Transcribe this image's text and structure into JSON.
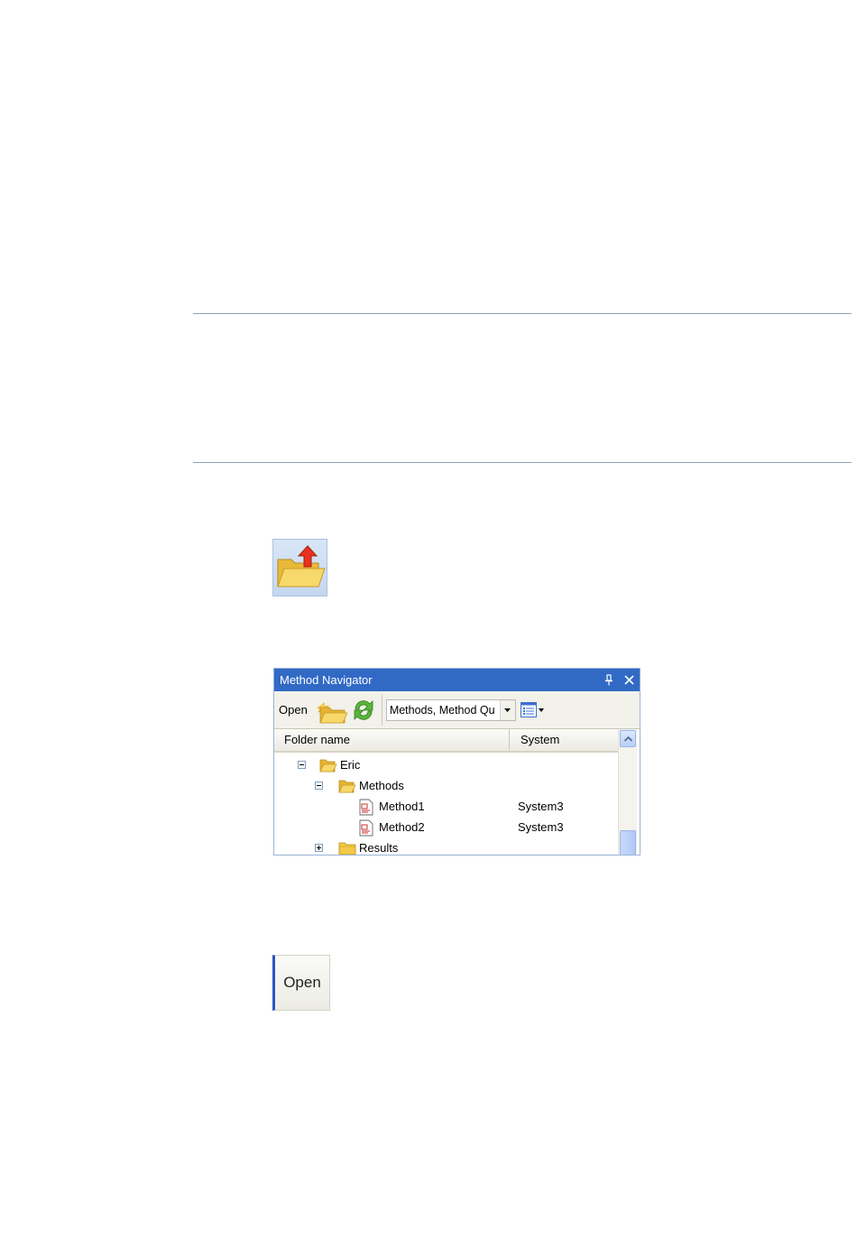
{
  "navigator": {
    "title": "Method Navigator",
    "toolbar": {
      "open_label": "Open",
      "filter_value": "Methods, Method Qu"
    },
    "columns": {
      "folder": "Folder name",
      "system": "System"
    },
    "tree": [
      {
        "label": "Eric",
        "system": "",
        "kind": "folder-open",
        "expander": "minus"
      },
      {
        "label": "Methods",
        "system": "",
        "kind": "folder-open",
        "expander": "minus"
      },
      {
        "label": "Method1",
        "system": "System3",
        "kind": "method-file",
        "expander": ""
      },
      {
        "label": "Method2",
        "system": "System3",
        "kind": "method-file",
        "expander": ""
      },
      {
        "label": "Results",
        "system": "",
        "kind": "folder",
        "expander": "plus"
      }
    ]
  },
  "open_button": {
    "label": "Open"
  },
  "icons": {
    "big_icon": "open-folder-icon",
    "new_folder": "new-folder-icon",
    "refresh": "refresh-icon",
    "view_list": "view-list-icon",
    "pin": "pin-icon",
    "close": "close-icon"
  },
  "colors": {
    "titlebar": "#316ac5",
    "folder_yellow": "#f3c948",
    "refresh_green": "#4aa32c",
    "open_button_accent": "#2a56c6"
  }
}
